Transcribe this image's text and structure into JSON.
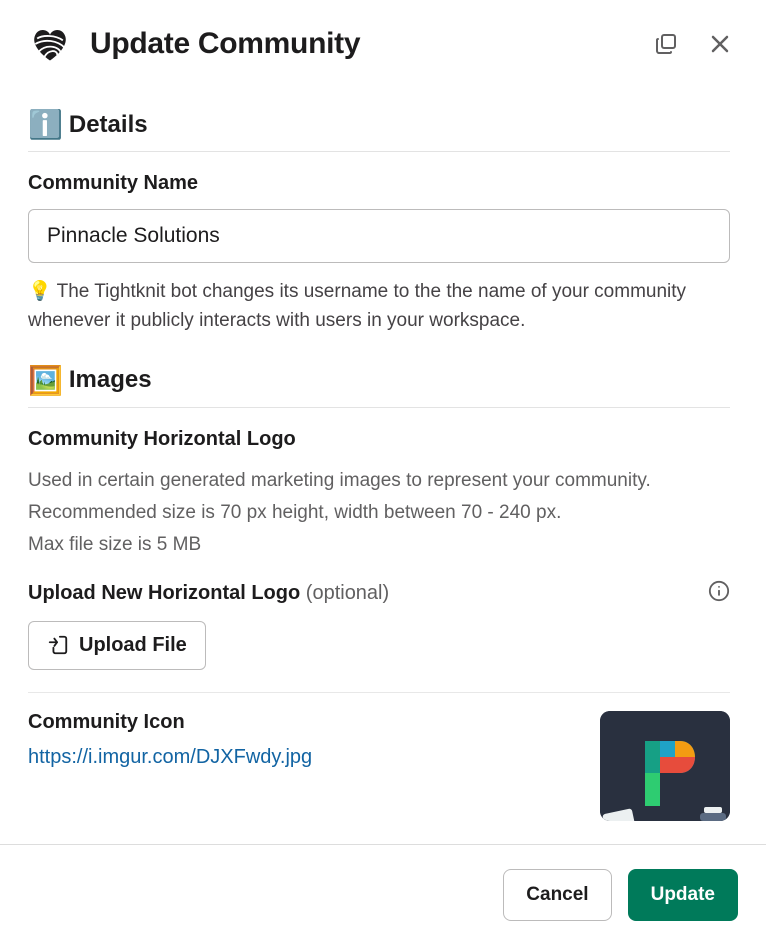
{
  "header": {
    "title": "Update Community"
  },
  "details": {
    "heading": "Details",
    "emoji": "ℹ️",
    "community_name_label": "Community Name",
    "community_name_value": "Pinnacle Solutions",
    "hint": "💡 The Tightknit bot changes its username to the the name of your community whenever it publicly interacts with users in your workspace."
  },
  "images": {
    "heading": "Images",
    "emoji": "🖼️",
    "horizontal_logo_label": "Community Horizontal Logo",
    "horizontal_logo_desc": "Used in certain generated marketing images to represent your community.\nRecommended size is 70 px height, width between 70 - 240 px.\nMax file size is 5 MB",
    "upload_label": "Upload New Horizontal Logo",
    "upload_optional": "(optional)",
    "upload_btn": "Upload File",
    "icon_label": "Community Icon",
    "icon_url": "https://i.imgur.com/DJXFwdy.jpg"
  },
  "footer": {
    "cancel": "Cancel",
    "update": "Update"
  }
}
